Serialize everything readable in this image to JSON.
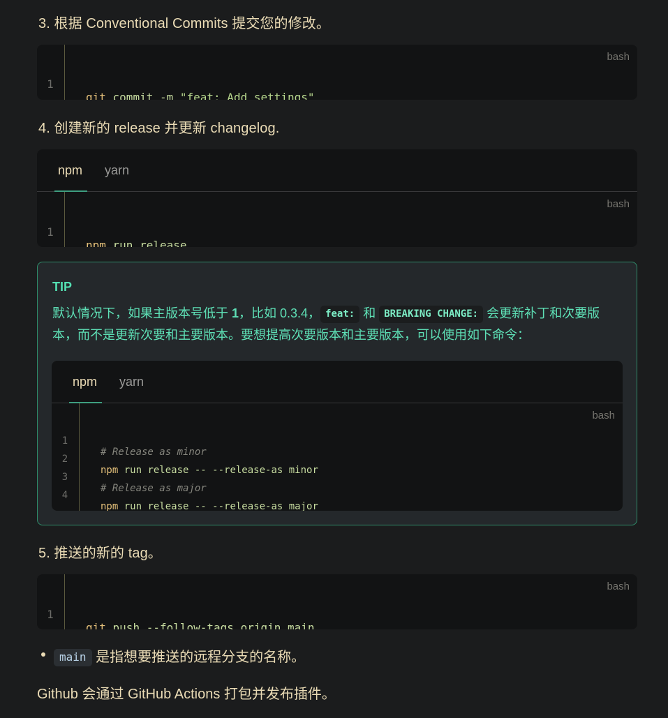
{
  "steps": {
    "s3": "3. 根据 Conventional Commits 提交您的修改。",
    "s4": "4. 创建新的 release 并更新 changelog.",
    "s5": "5. 推送的新的 tag。"
  },
  "code1": {
    "lang": "bash",
    "lines": [
      {
        "n": "1",
        "cmd": "git",
        "rest": " commit -m ",
        "str": "\"feat: Add settings\""
      }
    ]
  },
  "code2": {
    "tabs": [
      "npm",
      "yarn"
    ],
    "lang": "bash",
    "lines": [
      {
        "n": "1",
        "cmd": "npm",
        "rest": " run release"
      }
    ]
  },
  "tip": {
    "title": "TIP",
    "text_1": "默认情况下，如果主版本号低于 ",
    "text_bold": "1",
    "text_2": "，比如 0.3.4，",
    "code_feat": "feat:",
    "text_3": " 和 ",
    "code_breaking": "BREAKING CHANGE:",
    "text_4": " 会更新补丁和次要版本，而不是更新次要和主要版本。要想提高次要版本和主要版本，可以使用如下命令：",
    "code": {
      "tabs": [
        "npm",
        "yarn"
      ],
      "lang": "bash",
      "lines": [
        {
          "n": "1",
          "comment": "# Release as minor"
        },
        {
          "n": "2",
          "cmd": "npm",
          "rest": " run release -- --release-as minor"
        },
        {
          "n": "3",
          "comment": "# Release as major"
        },
        {
          "n": "4",
          "cmd": "npm",
          "rest": " run release -- --release-as major"
        }
      ]
    }
  },
  "code3": {
    "lang": "bash",
    "lines": [
      {
        "n": "1",
        "cmd": "git",
        "rest": " push --follow-tags origin main"
      }
    ]
  },
  "bullet": {
    "code": "main",
    "text": " 是指想要推送的远程分支的名称。"
  },
  "paragraph": "Github 会通过 GitHub Actions 打包并发布插件。",
  "colors": {
    "background": "#1b1c1d",
    "code_bg": "#121314",
    "tip_border": "#2f8d6a",
    "tip_text": "#5ee0b6",
    "accent_underline": "#3e9e80"
  }
}
